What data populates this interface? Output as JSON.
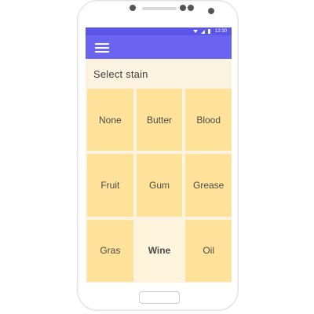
{
  "status_bar": {
    "time": "12:30",
    "icons": [
      "wifi-icon",
      "signal-icon",
      "battery-icon"
    ]
  },
  "app_bar": {
    "menu_icon": "hamburger-menu-icon"
  },
  "screen": {
    "title": "Select stain",
    "stains": [
      {
        "label": "None"
      },
      {
        "label": "Butter"
      },
      {
        "label": "Blood"
      },
      {
        "label": "Fruit"
      },
      {
        "label": "Gum"
      },
      {
        "label": "Grease"
      },
      {
        "label": "Gras"
      },
      {
        "label": "Wine",
        "selected": true
      },
      {
        "label": "Oil"
      }
    ]
  },
  "colors": {
    "app_bar": "#6b63f2",
    "status_bar": "#5b56e8",
    "tile": "#ffe29a",
    "tile_selected": "#fff4dc",
    "background": "#fbf3df"
  }
}
